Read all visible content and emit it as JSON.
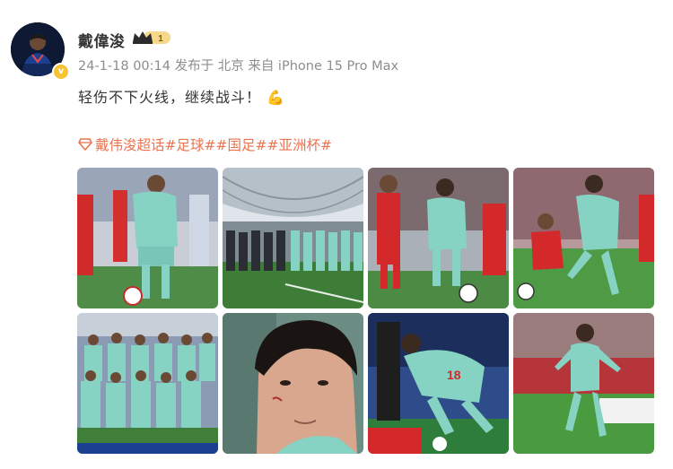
{
  "user": {
    "name": "戴偉浚",
    "level_badge": "1",
    "verified_mark": "v"
  },
  "meta": {
    "text": "24-1-18 00:14 发布于 北京 来自 iPhone 15 Pro Max"
  },
  "post": {
    "text": "轻伤不下火线，继续战斗！",
    "emoji": "💪"
  },
  "tags": [
    "戴伟浚超话",
    "#足球#",
    "#国足#",
    "#亚洲杯#"
  ],
  "colors": {
    "tag_orange": "#eb7350",
    "meta_gray": "#8d8d8d",
    "jersey_mint": "#7fd1c0",
    "opponent_red": "#d8282b",
    "pitch_green": "#3f8f3a"
  },
  "icons": {
    "super_topic": "diamond-icon",
    "crown": "crown-icon"
  }
}
